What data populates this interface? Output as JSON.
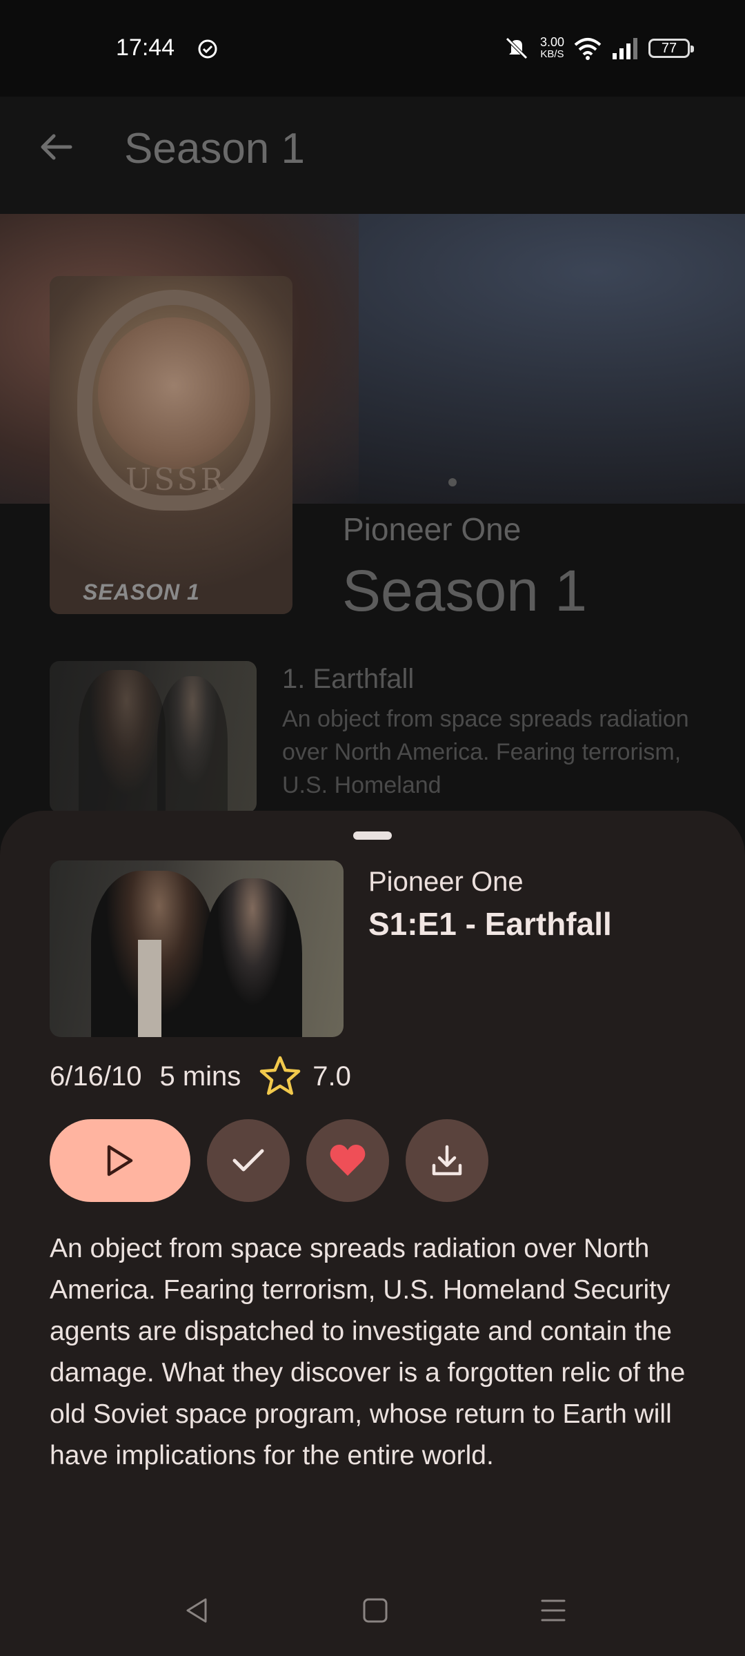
{
  "status_bar": {
    "time": "17:44",
    "speed_value": "3.00",
    "speed_unit": "KB/S",
    "battery": "77"
  },
  "app_bar": {
    "title": "Season 1"
  },
  "header": {
    "poster_label": "SEASON 1",
    "poster_text": "USSR",
    "show_name": "Pioneer One",
    "season_title": "Season 1"
  },
  "episode_list": [
    {
      "title": "1. Earthfall",
      "description": "An object from space spreads radiation over North America. Fearing terrorism, U.S. Homeland"
    }
  ],
  "sheet": {
    "show_name": "Pioneer One",
    "episode_title": "S1:E1 - Earthfall",
    "air_date": "6/16/10",
    "duration": "5 mins",
    "rating": "7.0",
    "overview": "An object from space spreads radiation over North America. Fearing terrorism, U.S. Homeland Security agents are dispatched to investigate and contain the damage. What they discover is a forgotten relic of the old Soviet space program, whose return to Earth will have implications for the entire world."
  },
  "colors": {
    "sheet_bg": "#221d1c",
    "play_button": "#ffb4a0",
    "action_button": "#5a433d",
    "favorite_heart": "#ef4f57",
    "star": "#f2c94c"
  },
  "icons": [
    "check-circle-icon",
    "mute-icon",
    "wifi-icon",
    "signal-icon",
    "battery-icon",
    "back-arrow-icon",
    "play-icon",
    "check-icon",
    "heart-icon",
    "download-icon",
    "star-icon",
    "nav-back-icon",
    "nav-home-icon",
    "nav-menu-icon"
  ]
}
